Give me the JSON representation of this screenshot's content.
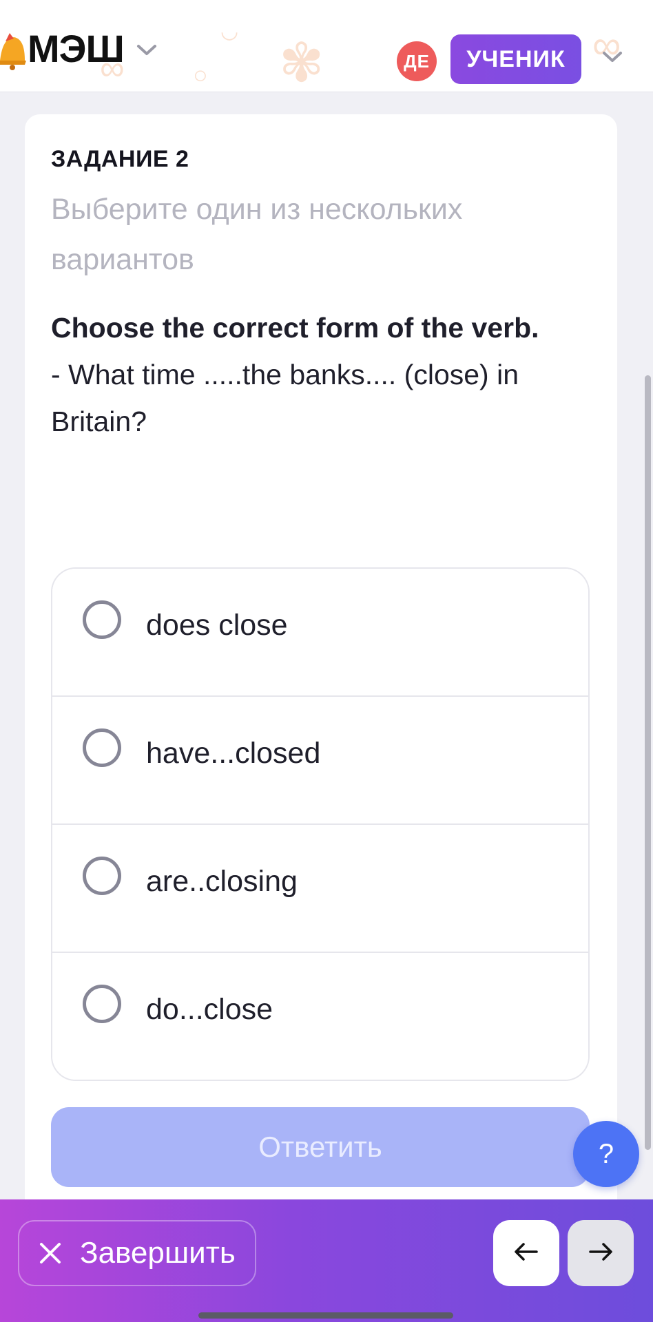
{
  "header": {
    "logo_text": "МЭШ",
    "avatar_initials": "ДЕ",
    "role_label": "УЧЕНИК"
  },
  "task": {
    "number": "ЗАДАНИЕ 2",
    "instruction": "Выберите один из нескольких вариантов",
    "question_bold": "Choose the correct form of the verb.",
    "question_text": "- What time .....the banks.... (close) in Britain?"
  },
  "options": [
    {
      "label": "does close"
    },
    {
      "label": "have...closed"
    },
    {
      "label": "are..closing"
    },
    {
      "label": "do...close"
    }
  ],
  "answer_button": "Ответить",
  "help_button": "?",
  "bottom_bar": {
    "finish_label": "Завершить"
  },
  "colors": {
    "accent": "#7a4fe2",
    "avatar": "#ee5b5b",
    "answer_disabled": "#a9b4f8",
    "help": "#4d73f5"
  }
}
